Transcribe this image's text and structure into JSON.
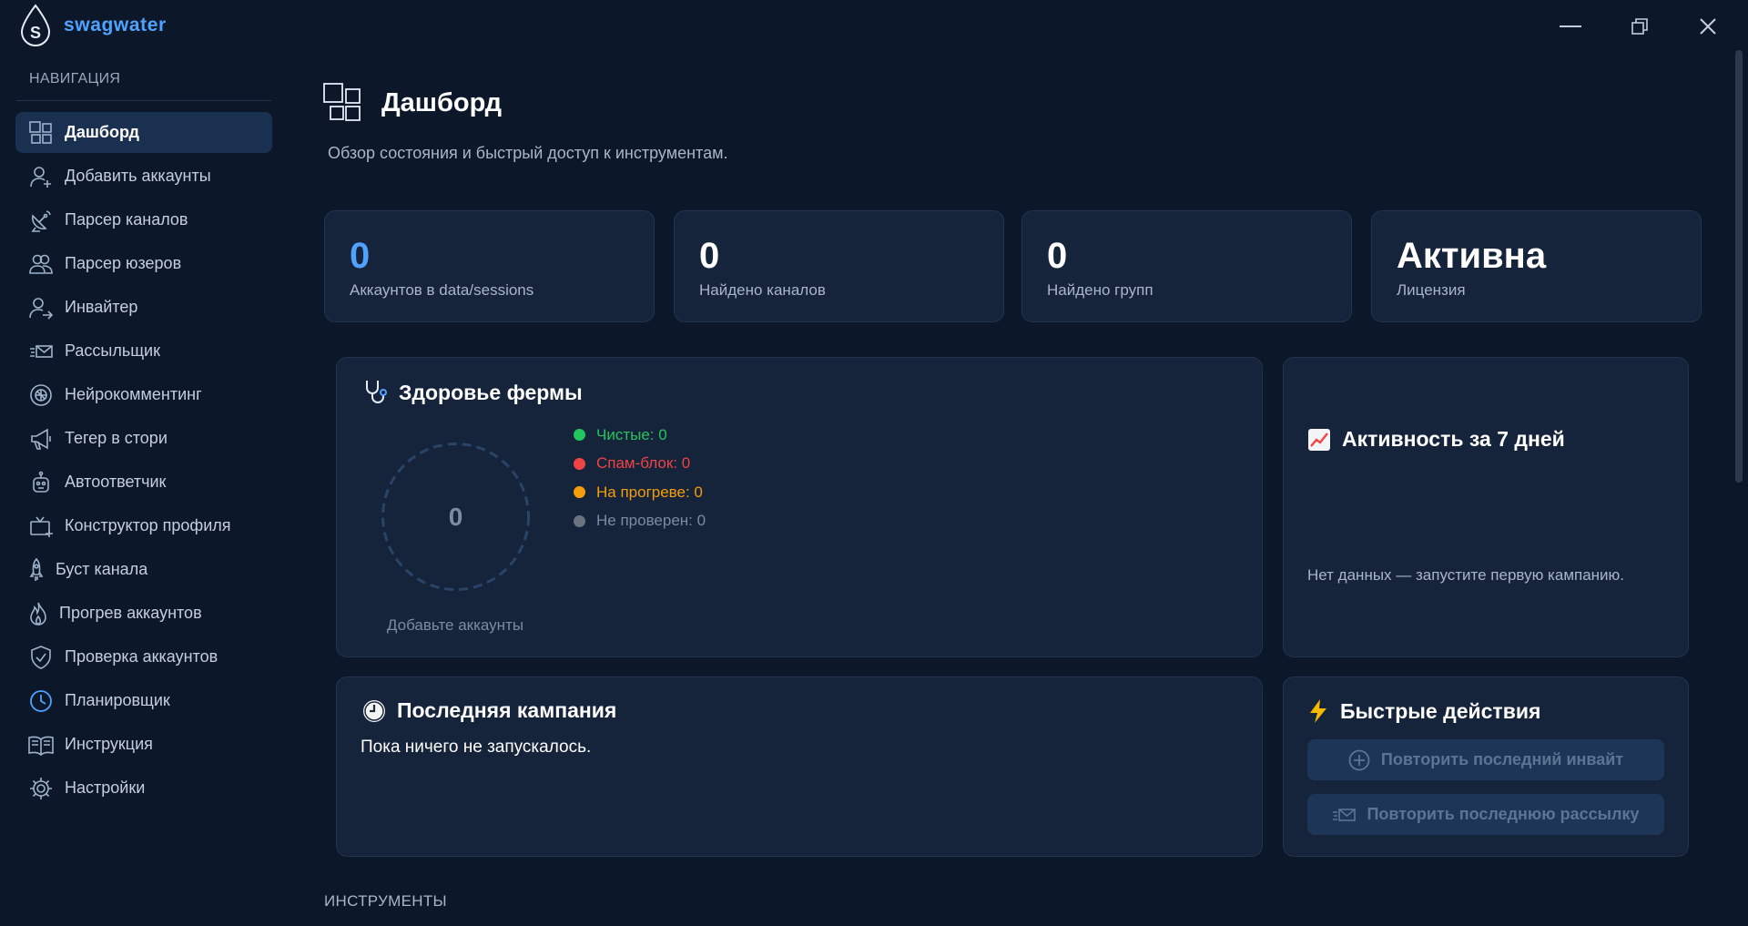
{
  "app": {
    "name": "swagwater"
  },
  "window_controls": {
    "minimize": "minimize-icon",
    "maximize": "restore-icon",
    "close": "close-icon"
  },
  "sidebar": {
    "heading": "НАВИГАЦИЯ",
    "items": [
      {
        "label": "Дашборд",
        "icon": "dashboard-icon",
        "active": true
      },
      {
        "label": "Добавить аккаунты",
        "icon": "add-user-icon"
      },
      {
        "label": "Парсер каналов",
        "icon": "satellite-dish-icon"
      },
      {
        "label": "Парсер юзеров",
        "icon": "users-icon"
      },
      {
        "label": "Инвайтер",
        "icon": "user-arrow-icon"
      },
      {
        "label": "Рассыльщик",
        "icon": "envelope-fast-icon"
      },
      {
        "label": "Нейрокомментинг",
        "icon": "brain-chip-icon"
      },
      {
        "label": "Тегер в стори",
        "icon": "megaphone-icon"
      },
      {
        "label": "Автоответчик",
        "icon": "robot-icon"
      },
      {
        "label": "Конструктор профиля",
        "icon": "tv-plus-icon"
      },
      {
        "label": "Буст канала",
        "icon": "rocket-icon"
      },
      {
        "label": "Прогрев аккаунтов",
        "icon": "flame-icon"
      },
      {
        "label": "Проверка аккаунтов",
        "icon": "shield-check-icon"
      },
      {
        "label": "Планировщик",
        "icon": "clock-icon"
      },
      {
        "label": "Инструкция",
        "icon": "book-icon"
      },
      {
        "label": "Настройки",
        "icon": "gear-icon"
      }
    ]
  },
  "header": {
    "title": "Дашборд",
    "subtitle": "Обзор состояния и быстрый доступ к инструментам."
  },
  "stats": [
    {
      "value": "0",
      "label": "Аккаунтов в data/sessions"
    },
    {
      "value": "0",
      "label": "Найдено каналов"
    },
    {
      "value": "0",
      "label": "Найдено групп"
    },
    {
      "value": "Активна",
      "label": "Лицензия"
    }
  ],
  "health": {
    "title": "Здоровье фермы",
    "total": "0",
    "caption": "Добавьте аккаунты",
    "legend": [
      {
        "label": "Чистые: 0",
        "color": "#22c55e"
      },
      {
        "label": "Спам-блок: 0",
        "color": "#ef4444"
      },
      {
        "label": "На прогреве: 0",
        "color": "#f59e0b"
      },
      {
        "label": "Не проверен: 0",
        "color": "#6b7280"
      }
    ]
  },
  "activity": {
    "title": "Активность за 7 дней",
    "empty": "Нет данных — запустите первую кампанию."
  },
  "last_campaign": {
    "title": "Последняя кампания",
    "empty": "Пока ничего не запускалось."
  },
  "quick_actions": {
    "title": "Быстрые действия",
    "buttons": [
      {
        "label": "Повторить последний инвайт",
        "icon": "plus-circle-icon"
      },
      {
        "label": "Повторить последнюю рассылку",
        "icon": "envelope-fast-icon"
      }
    ]
  },
  "tools": {
    "heading": "ИНСТРУМЕНТЫ"
  },
  "colors": {
    "accent": "#4fa3ff",
    "background": "#0c1829",
    "card": "#15233b"
  }
}
